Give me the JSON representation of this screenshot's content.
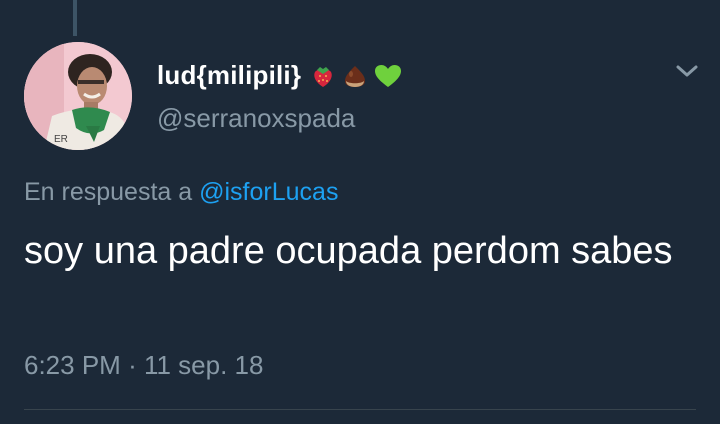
{
  "tweet": {
    "display_name": "lud{milipili}",
    "name_emojis": [
      "strawberry-icon",
      "chestnut-icon",
      "green-heart-icon"
    ],
    "handle": "@serranoxspada",
    "reply_prefix": "En respuesta a",
    "reply_mention": "@isforLucas",
    "text": "soy una padre ocupada perdom sabes",
    "time": "6:23 PM",
    "separator": "·",
    "date": "11 sep. 18"
  },
  "colors": {
    "background": "#1c2938",
    "secondary_text": "#8899a6",
    "link": "#1da1f2",
    "primary_text": "#ffffff"
  }
}
